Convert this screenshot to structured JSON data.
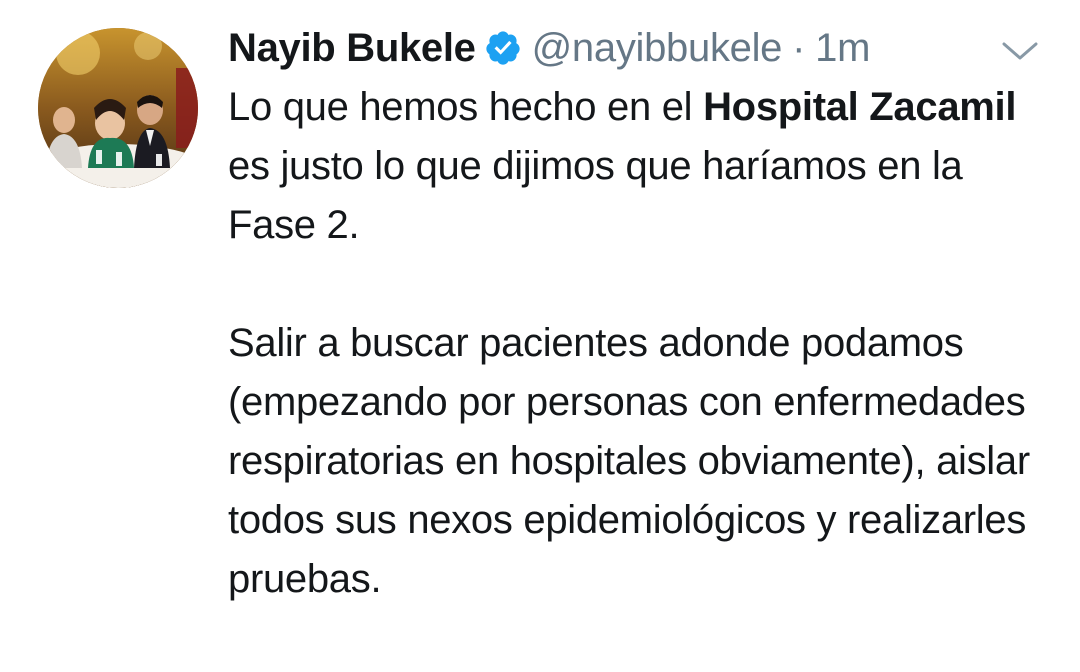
{
  "tweet": {
    "author_name": "Nayib Bukele",
    "author_handle": "@nayibbukele",
    "separator": "·",
    "timestamp": "1m",
    "verified_icon": "verified-badge-icon",
    "menu_icon": "chevron-down-icon",
    "paragraph1": {
      "part1": "Lo que hemos hecho en el ",
      "bold": "Hospital Zacamil",
      "part2": " es justo lo que dijimos que haríamos en la Fase 2."
    },
    "paragraph2": "Salir a buscar pacientes adonde podamos (empezando por personas con enfermedades respiratorias en hospitales obviamente), aislar todos sus nexos epidemiológicos y realizarles pruebas."
  },
  "colors": {
    "text": "#14171a",
    "secondary": "#657786",
    "verified": "#1da1f2"
  }
}
